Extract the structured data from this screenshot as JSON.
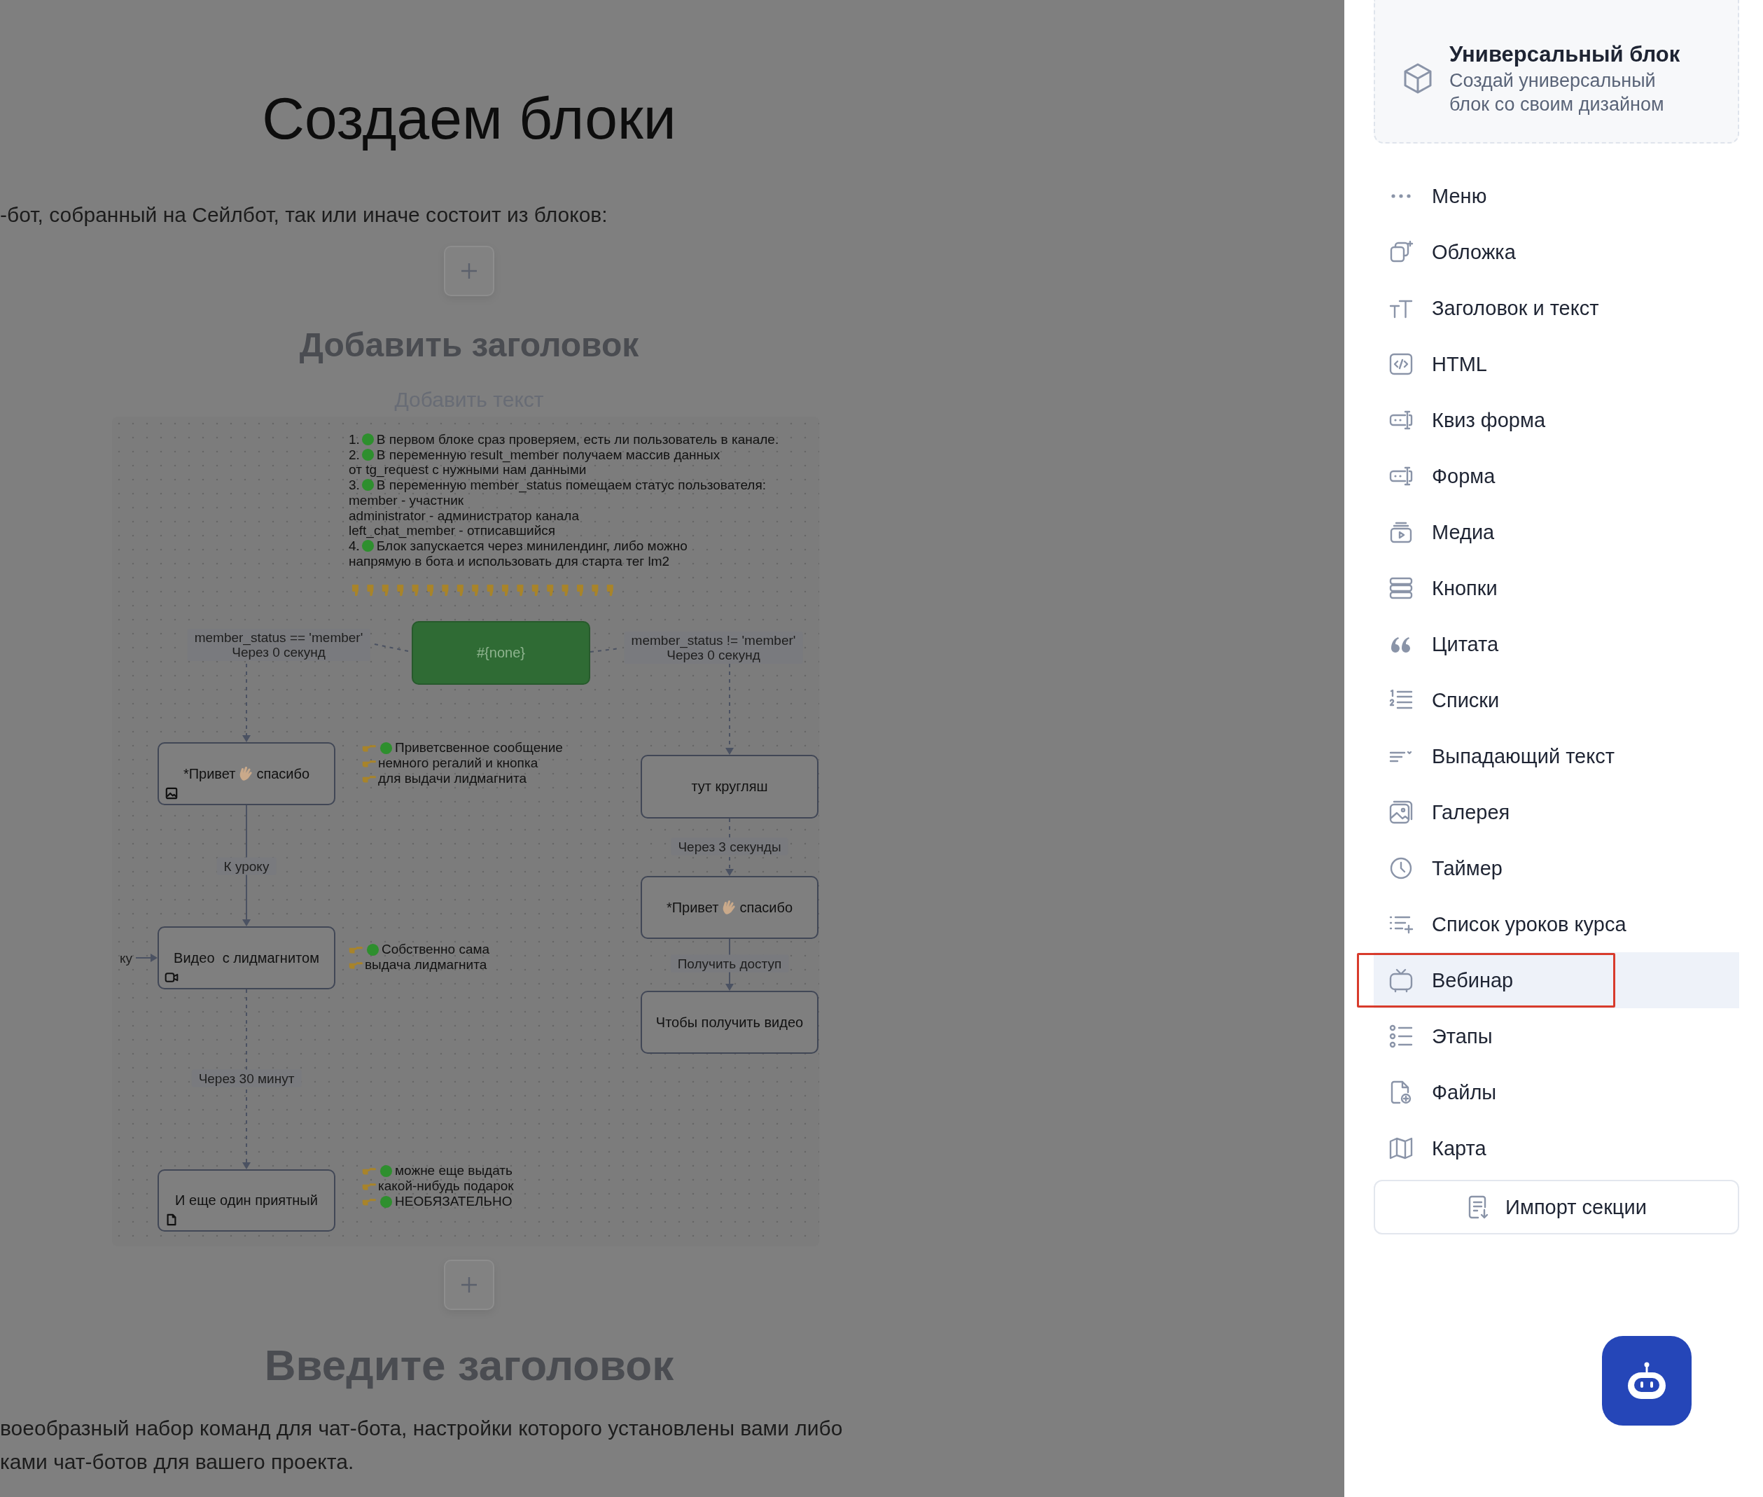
{
  "article": {
    "title": "Создаем блоки",
    "intro": "-бот, собранный на Сейлбот, так или иначе состоит из блоков:",
    "heading_placeholder": "Добавить заголовок",
    "text_placeholder": "Добавить текст",
    "heading_2_placeholder": "Введите заголовок",
    "paragraph_lines": [
      "воеобразный набор команд для чат-бота, настройки которого установлены вами либо",
      "ками чат-ботов для вашего проекта."
    ]
  },
  "diagram": {
    "notes": [
      {
        "number": "1.",
        "dot": true,
        "text": "В первом блоке сраз проверяем, есть ли пользователь в канале."
      },
      {
        "number": "2.",
        "dot": true,
        "text": "В переменную result_member получаем массив данных"
      },
      {
        "dot": false,
        "text": "от tg_request с нужными нам данными"
      },
      {
        "number": "3.",
        "dot": true,
        "text": "В переменную member_status помещаем статус пользователя:"
      },
      {
        "dot": false,
        "text": "member - участник"
      },
      {
        "dot": false,
        "text": "administrator - администратор канала"
      },
      {
        "dot": false,
        "text": "left_chat_member - отписавшийся"
      },
      {
        "number": "4.",
        "dot": true,
        "text": "Блок запускается через минилендинг, либо можно"
      },
      {
        "dot": false,
        "text": "напрямую в бота и использовать для старта тег lm2"
      }
    ],
    "nodes": [
      {
        "kind": "start",
        "label": "#{none}"
      },
      {
        "kind": "message",
        "label_parts": [
          "*Привет",
          "спасибо"
        ],
        "attachment": {
          "kind": "image"
        }
      },
      {
        "kind": "message",
        "label": "тут кругляш"
      },
      {
        "kind": "message",
        "label_parts": [
          "*Привет",
          "спасибо"
        ]
      },
      {
        "kind": "message",
        "label": "Чтобы получить видео"
      },
      {
        "kind": "message",
        "label": "Видео  с лидмагнитом",
        "attachment": {
          "kind": "video"
        }
      },
      {
        "kind": "message",
        "label": "И еще один приятный",
        "attachment": {
          "kind": "file"
        }
      }
    ],
    "edge_labels": [
      {
        "kind": "boxed",
        "lines": [
          "member_status == 'member'",
          "Через 0 секунд"
        ]
      },
      {
        "kind": "boxed",
        "lines": [
          "member_status != 'member'",
          "Через 0 секунд"
        ]
      },
      {
        "kind": "boxed",
        "lines": [
          "К уроку"
        ]
      },
      {
        "kind": "boxed",
        "lines": [
          "Через 3 секунды"
        ]
      },
      {
        "kind": "boxed",
        "lines": [
          "Получить доступ"
        ]
      },
      {
        "kind": "boxed",
        "lines": [
          "Через 30 минут"
        ]
      },
      {
        "kind": "plain",
        "lines": [
          "ку"
        ]
      }
    ],
    "comments": [
      {
        "lines": [
          {
            "dot": true,
            "text": "Приветсвенное сообщение"
          },
          {
            "dot": false,
            "text": "немного регалий и кнопка"
          },
          {
            "dot": false,
            "text": "для выдачи лидмагнита"
          }
        ]
      },
      {
        "lines": [
          {
            "dot": true,
            "text": "Собственно сама"
          },
          {
            "dot": false,
            "text": "выдача лидмагнита"
          }
        ]
      },
      {
        "lines": [
          {
            "dot": true,
            "text": "можне еще выдать"
          },
          {
            "dot": false,
            "text": "какой-нибудь подарок"
          },
          {
            "dot": true,
            "text": "НЕОБЯЗАТЕЛЬНО"
          }
        ]
      }
    ]
  },
  "sidebar": {
    "universal_block": {
      "title": "Универсальный блок",
      "subtitle": "Создай универсальный блок со своим дизайном"
    },
    "items": [
      {
        "kind": "menu",
        "label": "Меню",
        "selected": false,
        "highlighted": false
      },
      {
        "kind": "cover",
        "label": "Обложка",
        "selected": false,
        "highlighted": false
      },
      {
        "kind": "heading",
        "label": "Заголовок и текст",
        "selected": false,
        "highlighted": false
      },
      {
        "kind": "html",
        "label": "HTML",
        "selected": false,
        "highlighted": false
      },
      {
        "kind": "quiz",
        "label": "Квиз форма",
        "selected": false,
        "highlighted": false
      },
      {
        "kind": "form",
        "label": "Форма",
        "selected": false,
        "highlighted": false
      },
      {
        "kind": "media",
        "label": "Медиа",
        "selected": false,
        "highlighted": false
      },
      {
        "kind": "buttons",
        "label": "Кнопки",
        "selected": false,
        "highlighted": false
      },
      {
        "kind": "quote",
        "label": "Цитата",
        "selected": false,
        "highlighted": false
      },
      {
        "kind": "list",
        "label": "Списки",
        "selected": false,
        "highlighted": false
      },
      {
        "kind": "dropdown",
        "label": "Выпадающий текст",
        "selected": false,
        "highlighted": false
      },
      {
        "kind": "gallery",
        "label": "Галерея",
        "selected": false,
        "highlighted": false
      },
      {
        "kind": "timer",
        "label": "Таймер",
        "selected": false,
        "highlighted": false
      },
      {
        "kind": "lessons",
        "label": "Список уроков курса",
        "selected": false,
        "highlighted": false
      },
      {
        "kind": "webinar",
        "label": "Вебинар",
        "selected": true,
        "highlighted": true
      },
      {
        "kind": "stages",
        "label": "Этапы",
        "selected": false,
        "highlighted": false
      },
      {
        "kind": "files",
        "label": "Файлы",
        "selected": false,
        "highlighted": false
      },
      {
        "kind": "map",
        "label": "Карта",
        "selected": false,
        "highlighted": false
      }
    ],
    "import_button": "Импорт секции"
  }
}
